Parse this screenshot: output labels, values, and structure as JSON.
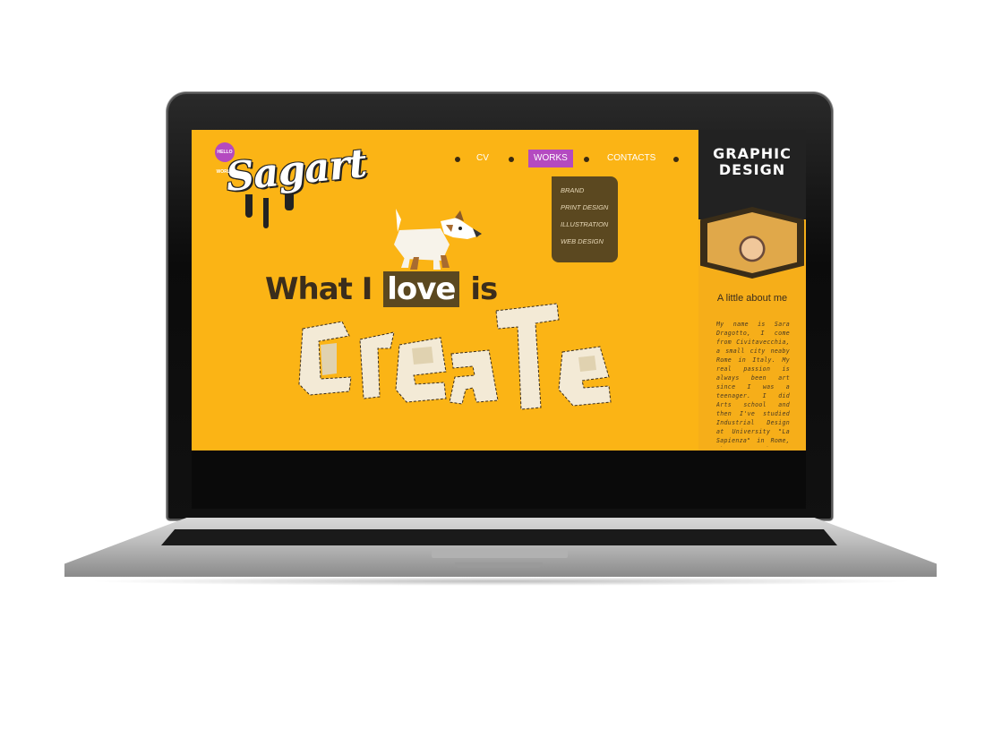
{
  "site": {
    "logo_text": "Sagart",
    "logo_badge": "HELLO WORLD"
  },
  "nav": {
    "items": [
      {
        "label": "CV"
      },
      {
        "label": "WORKS",
        "active": true
      },
      {
        "label": "CONTACTS"
      }
    ]
  },
  "dropdown": {
    "items": [
      "BRAND",
      "PRINT DESIGN",
      "ILLUSTRATION",
      "WEB DESIGN"
    ]
  },
  "hero": {
    "line_prefix": "What I",
    "highlight": "love",
    "line_suffix": "is",
    "big_word": "create"
  },
  "sidebar": {
    "brand_logo_text": "GRAPHIC DESIGN",
    "about_title": "A little about me",
    "about_text": "My name is Sara Dragotto, I come from Civitavecchia, a small city neaby Rome in Italy. My real passion is always been art since I was a teenager. I did Arts school and then I've studied Industrial Design at University \"La Sapienza\" in Rome, where I got the"
  },
  "colors": {
    "screen_bg": "#fbb415",
    "accent": "#b44ac0",
    "dark": "#3b2d1c"
  }
}
